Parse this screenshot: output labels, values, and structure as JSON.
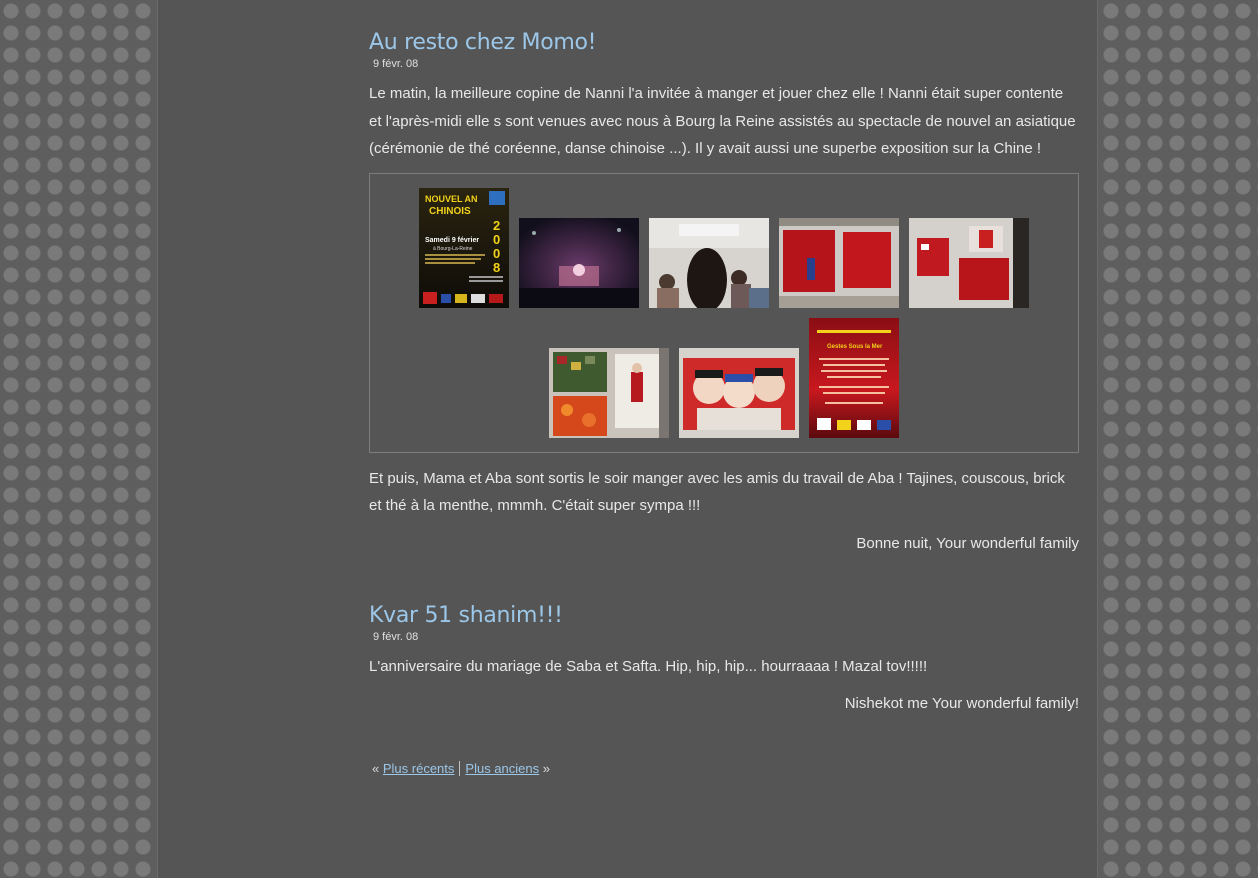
{
  "posts": [
    {
      "title": "Au resto chez Momo!",
      "date": "9 févr. 08",
      "paragraph1": "Le matin, la meilleure copine de Nanni l'a invitée à manger et jouer chez elle ! Nanni était super contente et l'après-midi elle s sont venues avec nous à Bourg la Reine assistés au spectacle de nouvel an asiatique (cérémonie de thé coréenne, danse chinoise ...). Il y avait aussi une superbe exposition sur la Chine !",
      "poster": {
        "line1": "NOUVEL AN",
        "line2": "CHINOIS",
        "year": "2008",
        "date_line": "Samedi 9 février",
        "place": "à Bourg-La-Reine"
      },
      "flyer": {
        "title": "Gestes Sous la Mer"
      },
      "paragraph2": "Et puis, Mama et Aba sont sortis le soir manger avec les amis du travail de Aba ! Tajines, couscous, brick et thé à la menthe, mmmh. C'était super sympa !!!",
      "signature": "Bonne nuit, Your wonderful family"
    },
    {
      "title": "Kvar 51 shanim!!!",
      "date": "9 févr. 08",
      "paragraph1": "L'anniversaire du mariage de Saba et Safta. Hip, hip, hip... hourraaaa ! Mazal tov!!!!!",
      "signature": "Nishekot me Your wonderful family!"
    }
  ],
  "pagination": {
    "open": "«",
    "newer": "Plus récents",
    "older": "Plus anciens",
    "close": "»"
  },
  "colors": {
    "title": "#9cc7e8",
    "page_bg": "#555555",
    "text": "#e8e8e8"
  }
}
